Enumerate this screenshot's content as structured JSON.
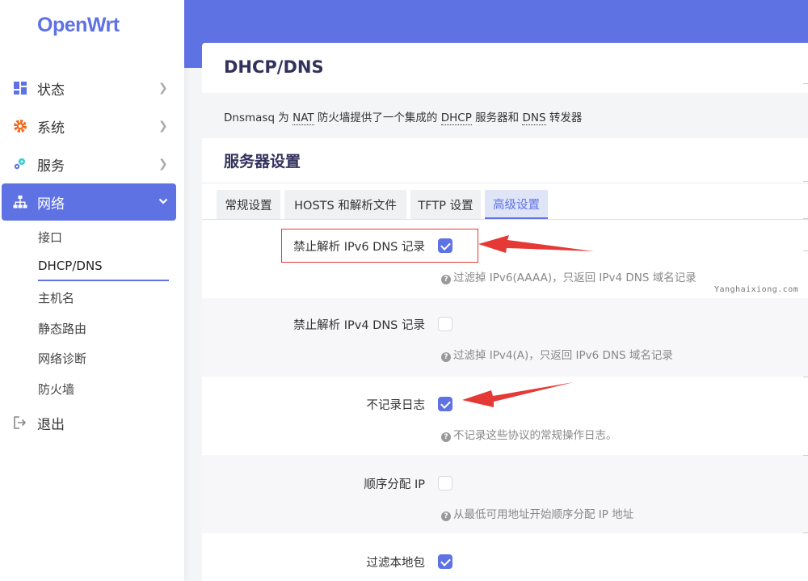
{
  "app": {
    "logo": "OpenWrt"
  },
  "sidebar": {
    "items": [
      {
        "label": "状态",
        "icon": "dashboard-icon"
      },
      {
        "label": "系统",
        "icon": "gear-icon"
      },
      {
        "label": "服务",
        "icon": "puzzle-icon"
      },
      {
        "label": "网络",
        "icon": "network-icon"
      },
      {
        "label": "退出",
        "icon": "logout-icon"
      }
    ],
    "network_sub": [
      "接口",
      "DHCP/DNS",
      "主机名",
      "静态路由",
      "网络诊断",
      "防火墙"
    ]
  },
  "page": {
    "title": "DHCP/DNS",
    "desc_pre": "Dnsmasq 为 ",
    "desc_nat": "NAT",
    "desc_mid": " 防火墙提供了一个集成的 ",
    "desc_dhcp": "DHCP",
    "desc_mid2": " 服务器和 ",
    "desc_dns": "DNS",
    "desc_post": " 转发器"
  },
  "section": {
    "title": "服务器设置",
    "tabs": [
      "常规设置",
      "HOSTS 和解析文件",
      "TFTP 设置",
      "高级设置"
    ],
    "active_tab": "高级设置"
  },
  "options": [
    {
      "label": "禁止解析 IPv6 DNS 记录",
      "checked": true,
      "hint": "过滤掉 IPv6(AAAA)，只返回 IPv4 DNS 域名记录"
    },
    {
      "label": "禁止解析 IPv4 DNS 记录",
      "checked": false,
      "hint": "过滤掉 IPv4(A)，只返回 IPv6 DNS 域名记录"
    },
    {
      "label": "不记录日志",
      "checked": true,
      "hint": "不记录这些协议的常规操作日志。"
    },
    {
      "label": "顺序分配 IP",
      "checked": false,
      "hint": "从最低可用地址开始顺序分配 IP 地址"
    },
    {
      "label": "过滤本地包",
      "checked": true,
      "hint": ""
    }
  ],
  "watermark": "Yanghaixiong.com",
  "colors": {
    "accent": "#5e72e4",
    "annotation": "#e53935"
  }
}
